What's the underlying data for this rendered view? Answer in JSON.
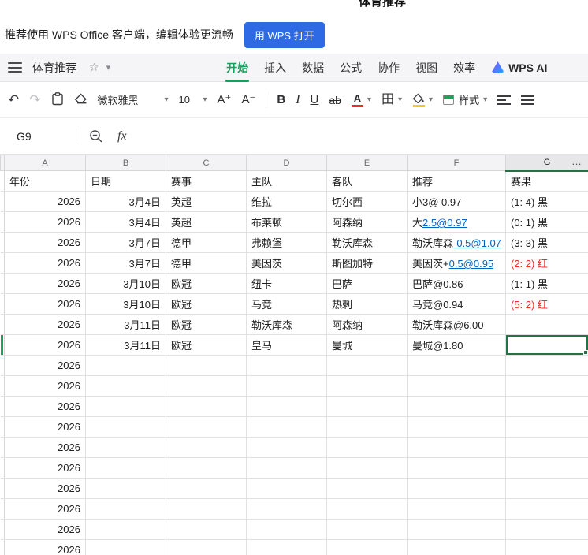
{
  "page": {
    "top_title": "体育推荐"
  },
  "banner": {
    "message": "推荐使用 WPS Office 客户端，编辑体验更流畅",
    "open_button": "用 WPS 打开"
  },
  "menu": {
    "doc_title": "体育推荐",
    "tabs": [
      {
        "label": "开始",
        "key": "home",
        "active": true
      },
      {
        "label": "插入",
        "key": "insert"
      },
      {
        "label": "数据",
        "key": "data"
      },
      {
        "label": "公式",
        "key": "formula"
      },
      {
        "label": "协作",
        "key": "collaborate"
      },
      {
        "label": "视图",
        "key": "view"
      },
      {
        "label": "效率",
        "key": "efficiency"
      }
    ],
    "ai_label": "WPS AI"
  },
  "toolbar": {
    "font_name": "微软雅黑",
    "font_size": "10",
    "style_label": "样式"
  },
  "icons": {
    "undo_glyph": "↶",
    "redo_glyph": "↷",
    "star_glyph": "☆",
    "caret_glyph": "▾",
    "font_increase_glyph": "A⁺",
    "font_decrease_glyph": "A⁻",
    "bold_glyph": "B",
    "italic_glyph": "I",
    "underline_glyph": "U",
    "strikethrough_glyph": "ab",
    "font_color_glyph": "A",
    "borders_glyph": "田"
  },
  "formula_bar": {
    "cell_ref": "G9",
    "fx_label": "fx"
  },
  "grid": {
    "column_letters": [
      "A",
      "B",
      "C",
      "D",
      "E",
      "F",
      "G"
    ],
    "selected_column": "G",
    "more_columns_indicator": "…",
    "selected_cell": "G9",
    "header_row": [
      "年份",
      "日期",
      "赛事",
      "主队",
      "客队",
      "推荐",
      "赛果"
    ],
    "rows": [
      {
        "year": "2026",
        "date": "3月4日",
        "event": "英超",
        "home": "维拉",
        "away": "切尔西",
        "rec": [
          {
            "text": "小3@ 0.97"
          }
        ],
        "result": "(1: 4) 黑",
        "result_color": "black"
      },
      {
        "year": "2026",
        "date": "3月4日",
        "event": "英超",
        "home": "布莱顿",
        "away": "阿森纳",
        "rec": [
          {
            "text": "大"
          },
          {
            "text": "2.5@0.97",
            "link": true
          }
        ],
        "result": "(0: 1) 黑",
        "result_color": "black"
      },
      {
        "year": "2026",
        "date": "3月7日",
        "event": "德甲",
        "home": "弗赖堡",
        "away": "勒沃库森",
        "rec": [
          {
            "text": "勒沃库森"
          },
          {
            "text": "-0.5@1.07",
            "link": true
          }
        ],
        "result": "(3: 3) 黑",
        "result_color": "black"
      },
      {
        "year": "2026",
        "date": "3月7日",
        "event": "德甲",
        "home": "美因茨",
        "away": "斯图加特",
        "rec": [
          {
            "text": "美因茨+"
          },
          {
            "text": "0.5@0.95",
            "link": true
          }
        ],
        "result": "(2: 2) 红",
        "result_color": "red"
      },
      {
        "year": "2026",
        "date": "3月10日",
        "event": "欧冠",
        "home": "纽卡",
        "away": "巴萨",
        "rec": [
          {
            "text": "巴萨@0.86"
          }
        ],
        "result": "(1: 1) 黑",
        "result_color": "black"
      },
      {
        "year": "2026",
        "date": "3月10日",
        "event": "欧冠",
        "home": "马竞",
        "away": "热刺",
        "rec": [
          {
            "text": "马竞@0.94"
          }
        ],
        "result": "(5: 2) 红",
        "result_color": "red"
      },
      {
        "year": "2026",
        "date": "3月11日",
        "event": "欧冠",
        "home": "勒沃库森",
        "away": "阿森纳",
        "rec": [
          {
            "text": "勒沃库森@6.00"
          }
        ],
        "result": ""
      },
      {
        "year": "2026",
        "date": "3月11日",
        "event": "欧冠",
        "home": "皇马",
        "away": "曼城",
        "rec": [
          {
            "text": "曼城@1.80"
          }
        ],
        "result": "",
        "selected": true
      }
    ],
    "extra_year_rows": {
      "count": 10,
      "year": "2026"
    }
  },
  "colors": {
    "accent_green": "#12a15e",
    "selection_green": "#217346",
    "link_blue": "#0563c1",
    "result_red": "#ee2d20",
    "button_blue": "#2d6ae3"
  }
}
